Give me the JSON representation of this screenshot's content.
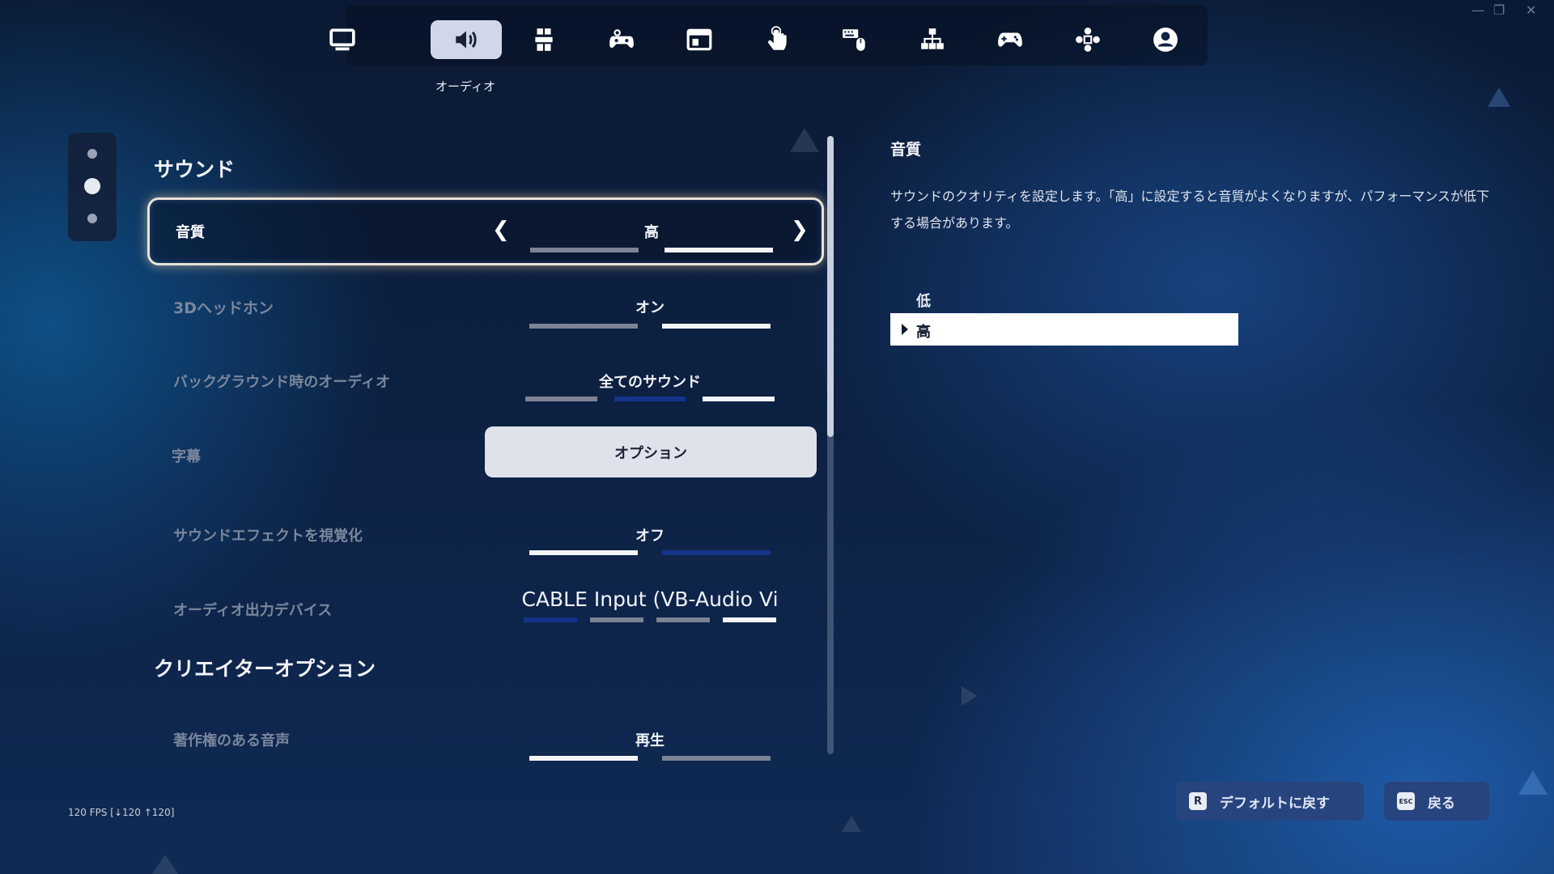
{
  "window": {
    "controls": [
      "—",
      "❐",
      "✕"
    ]
  },
  "tabs": [
    {
      "name": "display-icon"
    },
    {
      "name": "audio-icon",
      "caption": "オーディオ",
      "active": true
    },
    {
      "name": "accessibility-icon"
    },
    {
      "name": "controller-options-icon"
    },
    {
      "name": "window-icon"
    },
    {
      "name": "touch-icon"
    },
    {
      "name": "keyboard-mouse-icon"
    },
    {
      "name": "network-icon"
    },
    {
      "name": "gamepad-icon"
    },
    {
      "name": "controller-bindings-icon"
    },
    {
      "name": "account-icon"
    }
  ],
  "active_tab_caption": "オーディオ",
  "sections": {
    "sound": "サウンド",
    "creator": "クリエイターオプション"
  },
  "settings": {
    "quality": {
      "label": "音質",
      "value": "高"
    },
    "headphones": {
      "label": "3Dヘッドホン",
      "value": "オン"
    },
    "background_audio": {
      "label": "バックグラウンド時のオーディオ",
      "value": "全てのサウンド"
    },
    "subtitles": {
      "label": "字幕",
      "value": "オプション"
    },
    "visualize_sfx": {
      "label": "サウンドエフェクトを視覚化",
      "value": "オフ"
    },
    "output_device": {
      "label": "オーディオ出力デバイス",
      "value": "CABLE Input (VB-Audio Vi"
    },
    "copyrighted_audio": {
      "label": "著作権のある音声",
      "value": "再生"
    }
  },
  "description": {
    "title": "音質",
    "text": "サウンドのクオリティを設定します。「高」に設定すると音質がよくなりますが、パフォーマンスが低下する場合があります。",
    "options": [
      "低",
      "高"
    ],
    "selected": "高"
  },
  "fps": "120 FPS [↓120 ↑120]",
  "buttons": {
    "reset": {
      "key": "R",
      "label": "デフォルトに戻す"
    },
    "back": {
      "key": "ESC",
      "label": "戻る"
    }
  }
}
